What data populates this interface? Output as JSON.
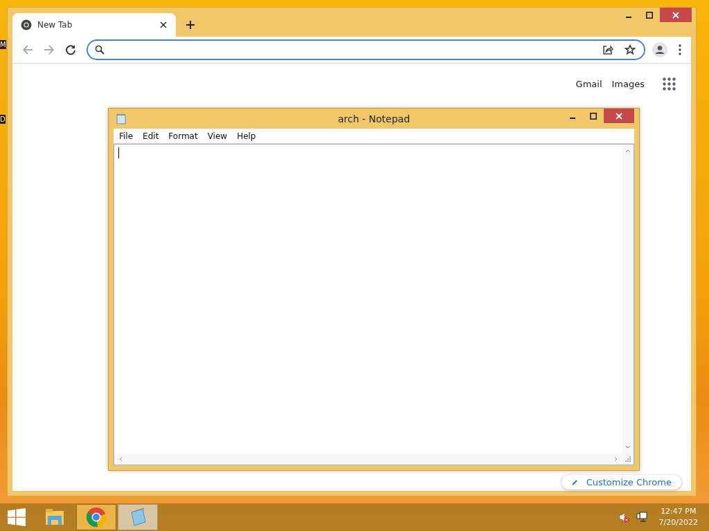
{
  "desktop": {
    "icon_labels": [
      "M",
      "D"
    ]
  },
  "browser": {
    "tabs": [
      {
        "title": "New Tab",
        "selected": true
      }
    ],
    "links": [
      "Gmail",
      "Images"
    ],
    "customize_button": "Customize Chrome"
  },
  "notepad": {
    "title": "arch - Notepad",
    "menu": [
      "File",
      "Edit",
      "Format",
      "View",
      "Help"
    ]
  },
  "taskbar": {
    "apps": [
      {
        "kind": "explorer",
        "running": false,
        "selected": false
      },
      {
        "kind": "chrome",
        "running": true,
        "selected": false
      },
      {
        "kind": "notepad",
        "running": true,
        "selected": true
      }
    ],
    "clock": {
      "time": "12:47 PM",
      "date": "7/20/2022"
    }
  }
}
